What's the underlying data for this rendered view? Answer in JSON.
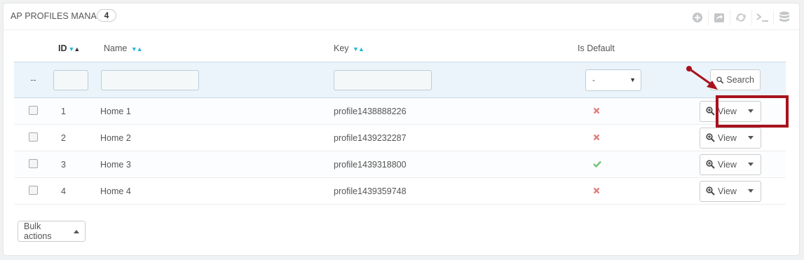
{
  "panel": {
    "title": "AP PROFILES MANAGE",
    "count": "4"
  },
  "toolbar": {
    "icons": [
      "add-icon",
      "export-icon",
      "refresh-icon",
      "sql-query-icon",
      "database-icon"
    ]
  },
  "columns": {
    "id": "ID",
    "name": "Name",
    "key": "Key",
    "is_default": "Is Default"
  },
  "filters": {
    "row_label": "--",
    "id_value": "",
    "name_value": "",
    "key_value": "",
    "is_default_selected": "-",
    "search_label": "Search"
  },
  "rows": [
    {
      "id": "1",
      "name": "Home 1",
      "key": "profile1438888226",
      "is_default": false,
      "action": "View"
    },
    {
      "id": "2",
      "name": "Home 2",
      "key": "profile1439232287",
      "is_default": false,
      "action": "View"
    },
    {
      "id": "3",
      "name": "Home 3",
      "key": "profile1439318800",
      "is_default": true,
      "action": "View"
    },
    {
      "id": "4",
      "name": "Home 4",
      "key": "profile1439359748",
      "is_default": false,
      "action": "View"
    }
  ],
  "bulk": {
    "label": "Bulk actions"
  },
  "colors": {
    "accent": "#25b9d7",
    "no": "#e08080",
    "yes": "#72c279",
    "highlight": "#a8121d"
  }
}
